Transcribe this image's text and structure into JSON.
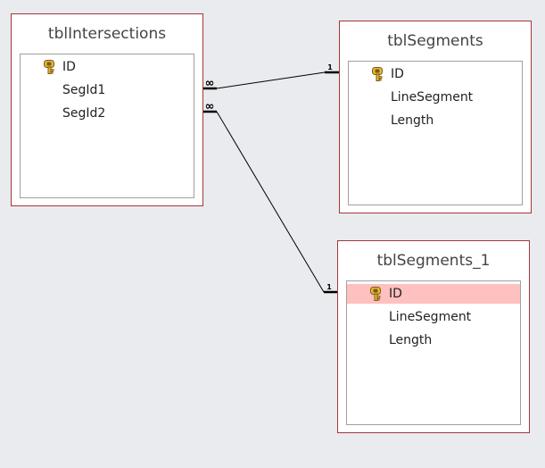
{
  "tables": [
    {
      "title": "tblIntersections",
      "fields": [
        {
          "name": "ID",
          "primary_key": true
        },
        {
          "name": "SegId1"
        },
        {
          "name": "SegId2"
        }
      ]
    },
    {
      "title": "tblSegments",
      "fields": [
        {
          "name": "ID",
          "primary_key": true
        },
        {
          "name": "LineSegment"
        },
        {
          "name": "Length"
        }
      ]
    },
    {
      "title": "tblSegments_1",
      "fields": [
        {
          "name": "ID",
          "primary_key": true,
          "selected": true
        },
        {
          "name": "LineSegment"
        },
        {
          "name": "Length"
        }
      ]
    }
  ],
  "relationships": [
    {
      "from": "tblIntersections.SegId1",
      "to": "tblSegments.ID",
      "many_label": "∞",
      "one_label": "1"
    },
    {
      "from": "tblIntersections.SegId2",
      "to": "tblSegments_1.ID",
      "many_label": "∞",
      "one_label": "1"
    }
  ],
  "colors": {
    "canvas": "#e9ebee",
    "table_border": "#a4373a",
    "selected_row": "#ffc0c0",
    "line": "#000000"
  },
  "icons": {
    "primary_key": "key-icon"
  }
}
